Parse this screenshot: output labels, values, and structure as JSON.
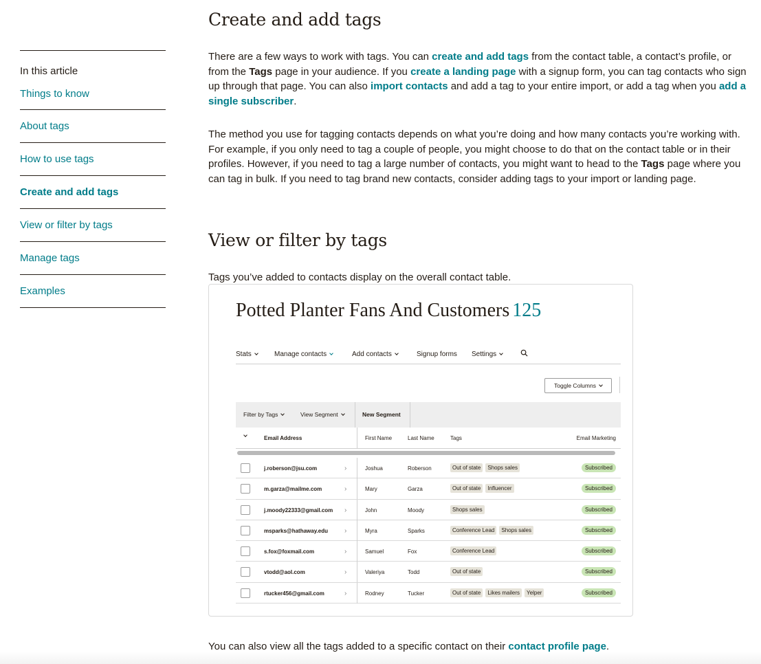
{
  "toc": {
    "heading": "In this article",
    "items": [
      {
        "label": "Things to know",
        "active": false
      },
      {
        "label": "About tags",
        "active": false
      },
      {
        "label": "How to use tags",
        "active": false
      },
      {
        "label": "Create and add tags",
        "active": true
      },
      {
        "label": "View or filter by tags",
        "active": false
      },
      {
        "label": "Manage tags",
        "active": false
      },
      {
        "label": "Examples",
        "active": false
      }
    ]
  },
  "sections": {
    "create": {
      "title": "Create and add tags",
      "p1": {
        "t1": "There are a few ways to work with tags. You can ",
        "l1": "create and add tags",
        "t2": " from the contact table, a contact’s profile, or from the ",
        "b1": "Tags",
        "t3": " page in your audience. If you ",
        "l2": "create a landing page",
        "t4": " with a signup form, you can tag contacts who sign up through that page. You can also ",
        "l3": "import contacts",
        "t5": " and add a tag to your entire import, or add a tag when you ",
        "l4": "add a single subscriber",
        "t6": "."
      },
      "p2": {
        "t1": "The method you use for tagging contacts depends on what you’re doing and how many contacts you’re working with. For example, if you only need to tag a couple of people, you might choose to do that on the contact table or in their profiles. However, if you need to tag a large number of contacts, you might want to head to the ",
        "b1": "Tags",
        "t2": " page where you can tag in bulk. If you need to tag brand new contacts, consider adding tags to your import or landing page."
      }
    },
    "view": {
      "title": "View or filter by tags",
      "p1": "Tags you’ve added to contacts display on the overall contact table.",
      "p2": {
        "t1": "You can also view all the tags added to a specific contact on their ",
        "l1": "contact profile page",
        "t2": "."
      }
    }
  },
  "figure": {
    "title": "Potted Planter Fans And Customers",
    "count": "125",
    "nav": {
      "stats": "Stats",
      "manage": "Manage contacts",
      "add": "Add contacts",
      "signup": "Signup forms",
      "settings": "Settings"
    },
    "toggle_columns": "Toggle Columns",
    "filter": {
      "filter_by_tags": "Filter by Tags",
      "view_segment": "View Segment",
      "new_segment": "New Segment"
    },
    "columns": {
      "email": "Email Address",
      "first": "First Name",
      "last": "Last Name",
      "tags": "Tags",
      "marketing": "Email Marketing"
    },
    "rows": [
      {
        "email": "j.roberson@jsu.com",
        "first": "Joshua",
        "last": "Roberson",
        "tags": [
          "Out of state",
          "Shops sales"
        ],
        "status": "Subscribed"
      },
      {
        "email": "m.garza@mailme.com",
        "first": "Mary",
        "last": "Garza",
        "tags": [
          "Out of state",
          "Influencer"
        ],
        "status": "Subscribed"
      },
      {
        "email": "j.moody22333@gmail.com",
        "first": "John",
        "last": "Moody",
        "tags": [
          "Shops sales"
        ],
        "status": "Subscribed"
      },
      {
        "email": "msparks@hathaway.edu",
        "first": "Myra",
        "last": "Sparks",
        "tags": [
          "Conference Lead",
          "Shops sales"
        ],
        "status": "Subscribed"
      },
      {
        "email": "s.fox@foxmail.com",
        "first": "Samuel",
        "last": "Fox",
        "tags": [
          "Conference Lead"
        ],
        "status": "Subscribed"
      },
      {
        "email": "vtodd@aol.com",
        "first": "Valeriya",
        "last": "Todd",
        "tags": [
          "Out of state"
        ],
        "status": "Subscribed"
      },
      {
        "email": "rtucker456@gmail.com",
        "first": "Rodney",
        "last": "Tucker",
        "tags": [
          "Out of state",
          "Likes mailers",
          "Yelper"
        ],
        "status": "Subscribed"
      }
    ]
  },
  "colors": {
    "link": "#007c89",
    "text": "#241c15",
    "subscribed_bg": "#c9e5b5",
    "tag_bg": "#e6e3d9"
  }
}
